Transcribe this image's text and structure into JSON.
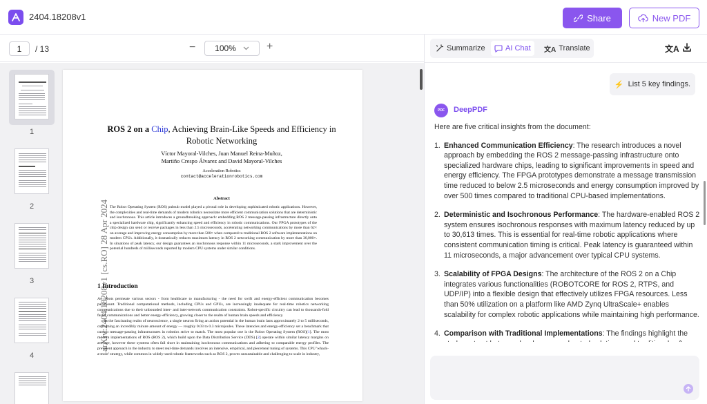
{
  "header": {
    "doc_title": "2404.18208v1",
    "share_label": "Share",
    "new_pdf_label": "New PDF"
  },
  "toolbar": {
    "current_page": "1",
    "total_pages": "/ 13",
    "zoom": "100%",
    "zoom_minus": "−",
    "zoom_plus": "+"
  },
  "thumbnails": [
    {
      "label": "1"
    },
    {
      "label": "2"
    },
    {
      "label": "3"
    },
    {
      "label": "4"
    }
  ],
  "paper": {
    "arxiv_stamp": "arXiv:2404.18208v1 [cs.RO] 28 Apr 2024",
    "title_pre": "ROS 2 on a ",
    "title_chip": "Chip",
    "title_post": ", Achieving Brain-Like Speeds and Efficiency in Robotic Networking",
    "authors_line1": "Víctor Mayoral-Vilches, Juan Manuel Reina-Muñoz,",
    "authors_line2": "Martiño Crespo Álvarez and David Mayoral-Vilches",
    "affiliation": "Acceleration Robotics",
    "email": "contact@accelerationrobotics.com",
    "abstract_heading": "Abstract",
    "abstract": "The Robot Operating System (ROS) pubsub model played a pivotal role in developing sophisticated robotic applications. However, the complexities and real-time demands of modern robotics necessitate more efficient communication solutions that are deterministic and isochronous. This article introduces a groundbreaking approach: embedding ROS 2 message-passing infrastructure directly onto a specialized hardware chip, significantly enhancing speed and efficiency in robotic communications. Our FPGA prototypes of the chip design can send or receive packages in less than 2.5 microseconds, accelerating networking communications by more than 62× on average and improving energy consumption by more than 500× when compared to traditional ROS 2 software implementations on modern CPUs. Additionally, it dramatically reduces maximum latency in ROS 2 networking communication by more than 30,000×. In situations of peak latency, our design guarantees an isochronous response within 11 microseconds, a stark improvement over the potential hundreds of milliseconds reported by modern CPU systems under similar conditions.",
    "intro_heading": "1   Introduction",
    "intro_p1": "As robots permeate various sectors - from healthcare to manufacturing - the need for swift and energy-efficient communication becomes paramount. Traditional computational methods, including CPUs and GPUs, are increasingly inadequate for real-time robotics networking communications due to their unbounded inter- and inter-network communication constraints. Robot-specific circuitry can lead to thousands-fold faster communications and better energy-efficiency, growing closer to the realm of human brain speeds and efficiency.",
    "intro_p2a": "In the fascinating realm of neuroscience, a single neuron firing an action potential in the human brain lasts approximately 2 to 5 milliseconds, consuming an incredibly minute amount of energy — roughly 0.03 to 0.3 microjoules. These latencies and energy-efficiency set a benchmark that current message-passing infrastructures in robotics strive to match. The most popular one is the Robot Operating System (ROS)[",
    "intro_cite1": "1",
    "intro_p2b": "]. The most modern implementations of ROS (ROS 2), which build upon the Data Distribution Service (DDS) [",
    "intro_cite2": "2",
    "intro_p2c": "] operate within similar latency margins on average, however these systems often fall short in maintaining isochronous communications and adhering to comparable energy profiles. The prevalent approach in the industry to meet real-time demands involves an intensive, empirical, and piecemeal tuning of systems. This CPU 'whack-a-mole' strategy, while common in widely-used robotic frameworks such as ROS 2, proves unsustainable and challenging to scale in industry,"
  },
  "panel": {
    "tabs": [
      {
        "label": "Summarize",
        "icon": "wand-icon"
      },
      {
        "label": "AI Chat",
        "icon": "chat-icon"
      },
      {
        "label": "Translate",
        "icon": "translate-icon"
      }
    ],
    "translate_icon_glyph": "文A",
    "user_message": "List 5 key findings.",
    "bot_avatar_text": "PDF",
    "bot_name": "DeepPDF",
    "answer_intro": "Here are five critical insights from the document:",
    "findings": [
      {
        "num": "1.",
        "title": "Enhanced Communication Efficiency",
        "text": ": The research introduces a novel approach by embedding the ROS 2 message-passing infrastructure onto specialized hardware chips, leading to significant improvements in speed and energy efficiency. The FPGA prototypes demonstrate a message transmission time reduced to below 2.5 microseconds and energy consumption improved by over 500 times compared to traditional CPU-based implementations."
      },
      {
        "num": "2.",
        "title": "Deterministic and Isochronous Performance",
        "text": ": The hardware-enabled ROS 2 system ensures isochronous responses with maximum latency reduced by up to 30,613 times. This is essential for real-time robotic applications where consistent communication timing is critical. Peak latency is guaranteed within 11 microseconds, a major advancement over typical CPU systems."
      },
      {
        "num": "3.",
        "title": "Scalability of FPGA Designs",
        "text": ": The architecture of the ROS 2 on a Chip integrates various functionalities (ROBOTCORE for ROS 2, RTPS, and UDP/IP) into a flexible design that effectively utilizes FPGA resources. Less than 50% utilization on a platform like AMD Zynq UltraScale+ enables scalability for complex robotic applications while maintaining high performance."
      },
      {
        "num": "4.",
        "title": "Comparison with Traditional Implementations",
        "text": ": The findings highlight the stark contrast between hardware-accelerated solutions and traditional software approaches. The FPGA implementation achieves negligible mean latencies (as"
      }
    ]
  },
  "colors": {
    "accent": "#8a56ee",
    "link": "#2a36d6"
  }
}
